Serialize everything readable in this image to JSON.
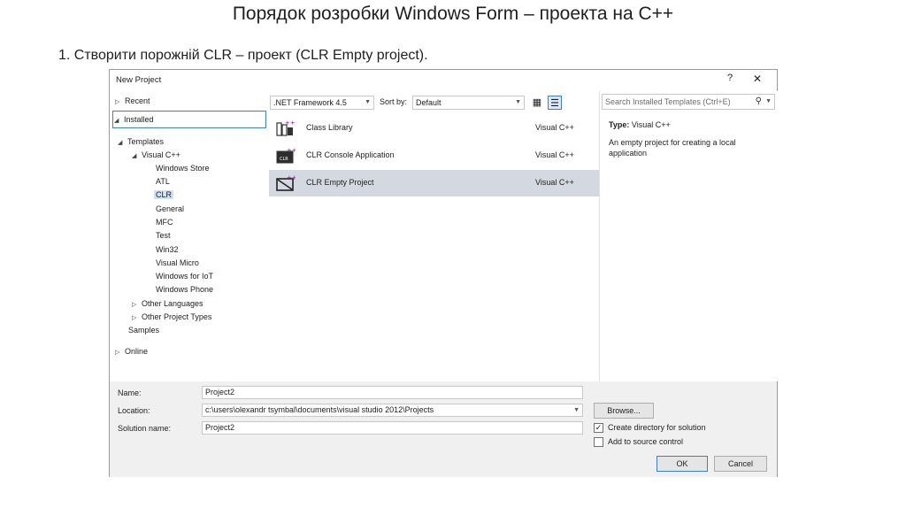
{
  "slide": {
    "title": "Порядок розробки  Windows Form – проекта на С++",
    "step": "1. Створити порожній CLR – проект (CLR Empty project)."
  },
  "dialog": {
    "title": "New Project",
    "help": "?",
    "close": "✕"
  },
  "tree": {
    "recent": "Recent",
    "installed": "Installed",
    "templates": "Templates",
    "visual_cpp": "Visual C++",
    "children": [
      "Windows Store",
      "ATL",
      "CLR",
      "General",
      "MFC",
      "Test",
      "Win32",
      "Visual Micro",
      "Windows for IoT",
      "Windows Phone"
    ],
    "other_languages": "Other Languages",
    "other_project_types": "Other Project Types",
    "samples": "Samples",
    "online": "Online"
  },
  "toolbar": {
    "framework": ".NET Framework 4.5",
    "sort_by_label": "Sort by:",
    "sort_by_value": "Default"
  },
  "templates": [
    {
      "name": "Class Library",
      "lang": "Visual C++"
    },
    {
      "name": "CLR Console Application",
      "lang": "Visual C++"
    },
    {
      "name": "CLR Empty Project",
      "lang": "Visual C++"
    }
  ],
  "details": {
    "search_placeholder": "Search Installed Templates (Ctrl+E)",
    "type_label": "Type:",
    "type_value": "Visual C++",
    "description": "An empty project for creating a local application"
  },
  "form": {
    "name_label": "Name:",
    "name_value": "Project2",
    "location_label": "Location:",
    "location_value": "c:\\users\\olexandr tsymbal\\documents\\visual studio 2012\\Projects",
    "solution_label": "Solution name:",
    "solution_value": "Project2",
    "browse": "Browse...",
    "create_dir": "Create directory for solution",
    "create_dir_checked": true,
    "add_source": "Add to source control",
    "add_source_checked": false,
    "ok": "OK",
    "cancel": "Cancel"
  },
  "colors": {
    "selection": "#d3d8e1",
    "accent": "#3b7ed6",
    "cpp_badge": "#68217a"
  }
}
